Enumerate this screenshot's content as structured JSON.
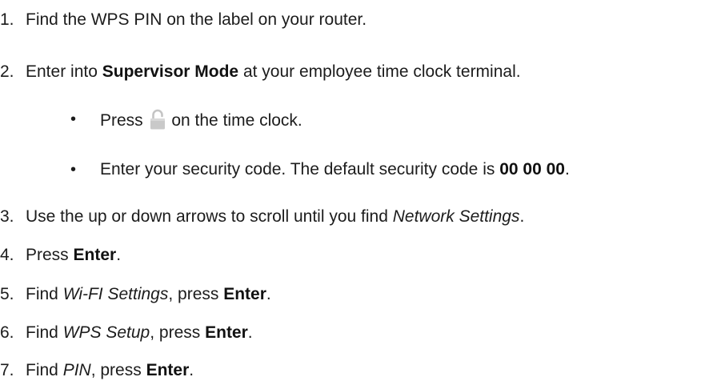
{
  "steps": [
    {
      "number": "1.",
      "text": "Find the WPS PIN on the label on your router."
    },
    {
      "number": "2.",
      "prefix": "Enter into ",
      "bold": "Supervisor Mode",
      "suffix": " at your employee time clock terminal.",
      "substeps": [
        {
          "bullet": "•",
          "before_icon": "Press ",
          "icon": "padlock-icon",
          "after_icon": " on the time clock."
        },
        {
          "bullet": "•",
          "prefix": "Enter your security code. The default security code is ",
          "bold": "00 00 00",
          "suffix": "."
        }
      ]
    },
    {
      "number": "3.",
      "prefix": "Use the up or down arrows to scroll until you find ",
      "italic": "Network Settings",
      "suffix": "."
    },
    {
      "number": "4.",
      "prefix": "Press ",
      "bold": "Enter",
      "suffix": "."
    },
    {
      "number": "5.",
      "prefix": "Find ",
      "italic": "Wi-FI Settings",
      "middle": ", press ",
      "bold": "Enter",
      "suffix": "."
    },
    {
      "number": "6.",
      "prefix": "Find ",
      "italic": "WPS Setup",
      "middle": ", press ",
      "bold": "Enter",
      "suffix": "."
    },
    {
      "number": "7.",
      "prefix": "Find ",
      "italic": "PIN",
      "middle": ", press ",
      "bold": "Enter",
      "suffix": "."
    }
  ]
}
